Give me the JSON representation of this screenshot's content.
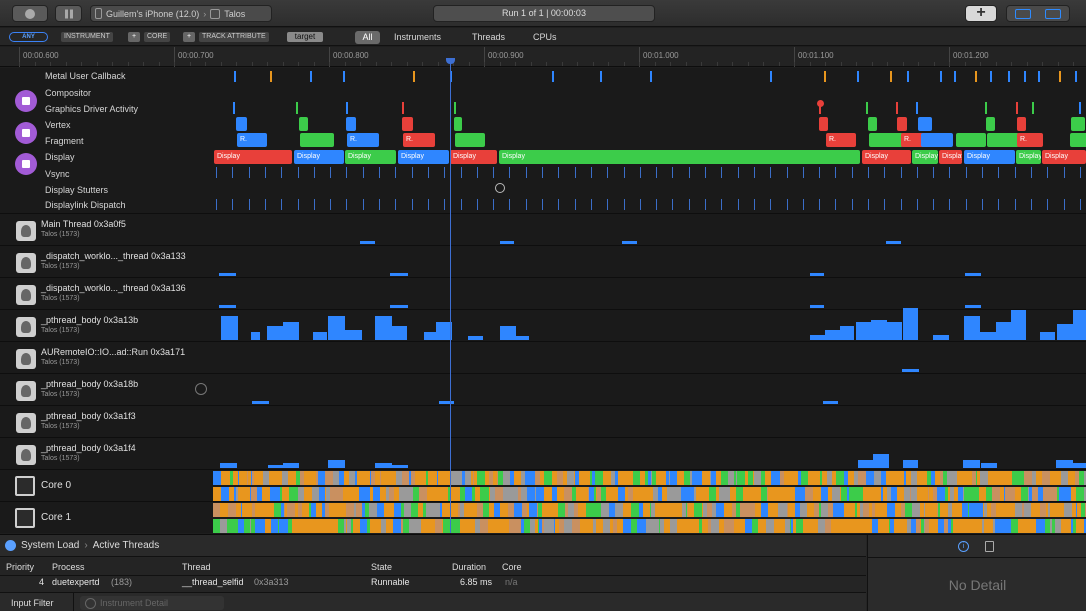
{
  "toolbar": {
    "device": "Guillem's iPhone (12.0)",
    "app": "Talos",
    "run_status": "Run 1 of 1  |  00:00:03",
    "add_label": "+"
  },
  "filter": {
    "any_label": "ANY",
    "tokens": [
      "INSTRUMENT",
      "CORE",
      "TRACK ATTRIBUTE"
    ],
    "plus_label": "+",
    "target_value": "target",
    "scopes": [
      "All",
      "Instruments",
      "Threads",
      "CPUs"
    ]
  },
  "ruler": {
    "labels": [
      "00:00.600",
      "00:00.700",
      "00:00.800",
      "00:00.900",
      "00:01.000",
      "00:01.100",
      "00:01.200"
    ]
  },
  "gpu_tracks": {
    "metal": "Metal User Callback",
    "compositor": "Compositor",
    "driver": "Graphics Driver Activity",
    "vertex": "Vertex",
    "fragment": "Fragment",
    "display": "Display",
    "vsync": "Vsync",
    "stutters": "Display Stutters",
    "displaylink": "Displaylink Dispatch",
    "fragment_mark": "R.",
    "display_segment_label": "Display"
  },
  "threads": [
    {
      "name": "Main Thread  0x3a0f5",
      "process": "Talos (1573)"
    },
    {
      "name": "_dispatch_worklo..._thread  0x3a133",
      "process": "Talos (1573)"
    },
    {
      "name": "_dispatch_worklo..._thread  0x3a136",
      "process": "Talos (1573)"
    },
    {
      "name": "_pthread_body  0x3a13b",
      "process": "Talos (1573)"
    },
    {
      "name": "AURemoteIO::IO...ad::Run  0x3a171",
      "process": "Talos (1573)"
    },
    {
      "name": "_pthread_body  0x3a18b",
      "process": "Talos (1573)"
    },
    {
      "name": "_pthread_body  0x3a1f3",
      "process": "Talos (1573)"
    },
    {
      "name": "_pthread_body  0x3a1f4",
      "process": "Talos (1573)"
    }
  ],
  "cores": [
    "Core 0",
    "Core 1"
  ],
  "breadcrumb": {
    "root": "System Load",
    "current": "Active Threads",
    "separator": "›"
  },
  "detail": {
    "columns": [
      "Priority",
      "Process",
      "Thread",
      "State",
      "Duration",
      "Core"
    ],
    "row": {
      "priority": "4",
      "process": "duetexpertd",
      "process_pid": "(183)",
      "thread": "__thread_selfid",
      "thread_id": "0x3a313",
      "state": "Runnable",
      "duration": "6.85 ms",
      "core": "n/a"
    }
  },
  "input_filter": {
    "label": "Input Filter",
    "placeholder": "Instrument Detail"
  },
  "right_pane": {
    "no_detail": "No Detail",
    "info_glyph": "i"
  },
  "colors": {
    "red": "#e8403a",
    "green": "#3ccc4a",
    "blue": "#2f86ff",
    "orange": "#e8961e",
    "purple": "#a25bd6"
  }
}
